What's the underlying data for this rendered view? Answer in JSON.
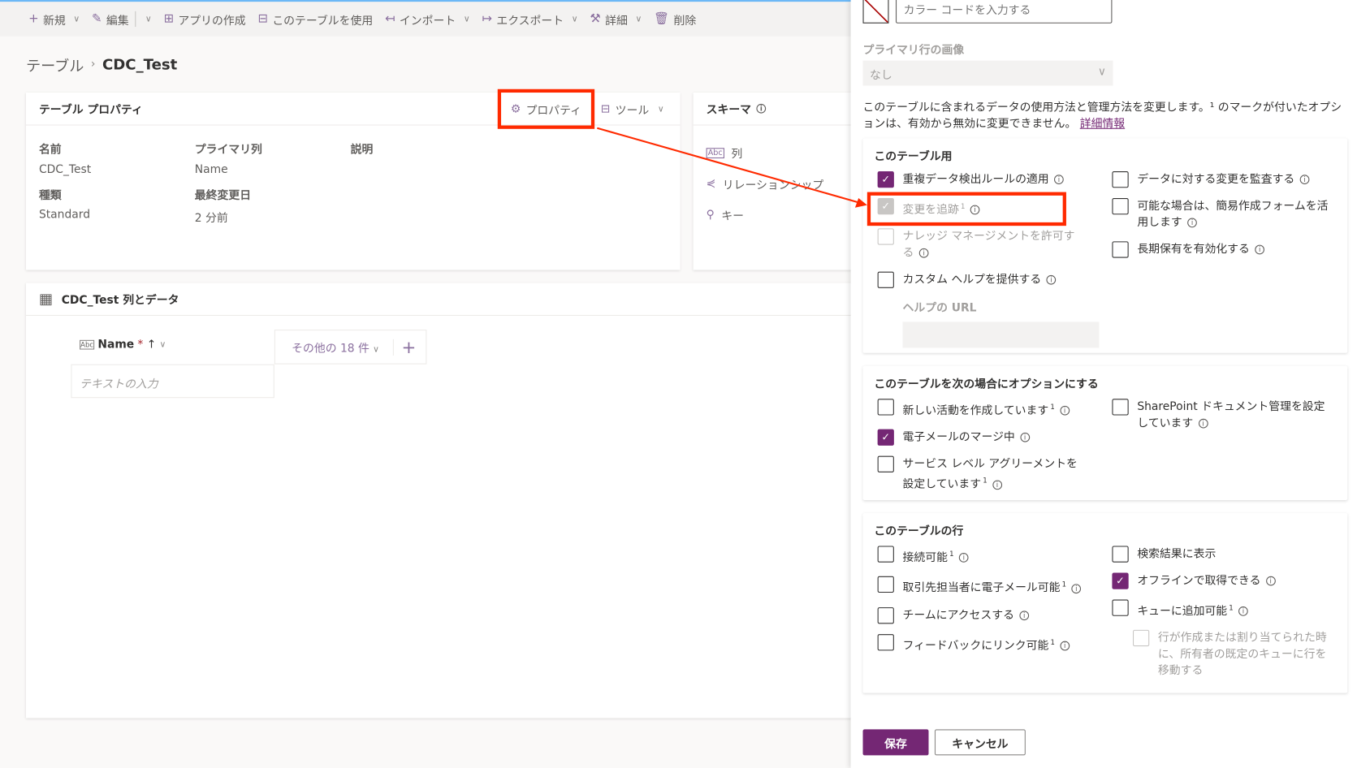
{
  "toolbar": {
    "items": [
      {
        "icon": "plus-icon",
        "glyph": "+",
        "label": "新規",
        "chevron": true
      },
      {
        "icon": "pencil-icon",
        "glyph": "✎",
        "label": "編集",
        "chevron": true,
        "sep": true
      },
      {
        "icon": "app-icon",
        "glyph": "⊞",
        "label": "アプリの作成"
      },
      {
        "icon": "table-icon",
        "glyph": "⊟",
        "label": "このテーブルを使用"
      },
      {
        "icon": "import-icon",
        "glyph": "↤",
        "label": "インポート",
        "chevron": true
      },
      {
        "icon": "export-icon",
        "glyph": "↦",
        "label": "エクスポート",
        "chevron": true
      },
      {
        "icon": "tools-icon",
        "glyph": "⚒",
        "label": "詳細",
        "chevron": true
      },
      {
        "icon": "trash-icon",
        "glyph": "🗑",
        "label": "削除"
      }
    ]
  },
  "breadcrumb": {
    "parent": "テーブル",
    "current": "CDC_Test"
  },
  "props": {
    "title": "テーブル プロパティ",
    "properties_btn": "プロパティ",
    "tools_btn": "ツール",
    "name_label": "名前",
    "name": "CDC_Test",
    "primary_label": "プライマリ列",
    "primary": "Name",
    "desc_label": "説明",
    "type_label": "種類",
    "type": "Standard",
    "modified_label": "最終変更日",
    "modified": "2 分前"
  },
  "schema": {
    "title": "スキーマ",
    "items": [
      "列",
      "リレーションシップ",
      "キー"
    ]
  },
  "data": {
    "title": "CDC_Test 列とデータ",
    "col": "Name",
    "required": "*",
    "more": "その他の 18 件",
    "placeholder": "テキストの入力"
  },
  "panel": {
    "color_placeholder": "カラー コードを入力する",
    "image_label": "プライマリ行の画像",
    "image_value": "なし",
    "desc": "このテーブルに含まれるデータの使用方法と管理方法を変更します。¹ のマークが付いたオプションは、有効から無効に変更できません。",
    "more_link": "詳細情報",
    "sections": [
      {
        "title": "このテーブル用",
        "left": [
          {
            "label": "重複データ検出ルールの適用",
            "info": true,
            "checked": true
          },
          {
            "label": "変更を追跡",
            "sup": "1",
            "info": true,
            "checked": true,
            "disabled": true
          },
          {
            "label": "ナレッジ マネージメントを許可する",
            "info": true,
            "disabled": true
          },
          {
            "label": "カスタム ヘルプを提供する",
            "info": true
          }
        ],
        "right": [
          {
            "label": "データに対する変更を監査する",
            "info": true
          },
          {
            "label": "可能な場合は、簡易作成フォームを活用します",
            "info": true
          },
          {
            "label": "長期保有を有効化する",
            "info": true
          }
        ],
        "help_url_label": "ヘルプの URL"
      },
      {
        "title": "このテーブルを次の場合にオプションにする",
        "left": [
          {
            "label": "新しい活動を作成しています",
            "sup": "1",
            "info": true
          },
          {
            "label": "電子メールのマージ中",
            "info": true,
            "checked": true
          },
          {
            "label": "サービス レベル アグリーメントを設定しています",
            "sup": "1",
            "info": true
          }
        ],
        "right": [
          {
            "label": "SharePoint ドキュメント管理を設定しています",
            "info": true
          }
        ]
      },
      {
        "title": "このテーブルの行",
        "left": [
          {
            "label": "接続可能",
            "sup": "1",
            "info": true
          },
          {
            "label": "取引先担当者に電子メール可能",
            "sup": "1",
            "info": true
          },
          {
            "label": "チームにアクセスする",
            "info": true
          },
          {
            "label": "フィードバックにリンク可能",
            "sup": "1",
            "info": true
          }
        ],
        "right": [
          {
            "label": "検索結果に表示"
          },
          {
            "label": "オフラインで取得できる",
            "info": true,
            "checked": true
          },
          {
            "label": "キューに追加可能",
            "sup": "1",
            "info": true
          },
          {
            "label": "行が作成または割り当てられた時に、所有者の既定のキューに行を移動する",
            "disabled": true,
            "indent": true
          }
        ]
      }
    ],
    "save": "保存",
    "cancel": "キャンセル"
  },
  "colors": {
    "accent": "#742774",
    "annotation": "#ff2a00"
  }
}
